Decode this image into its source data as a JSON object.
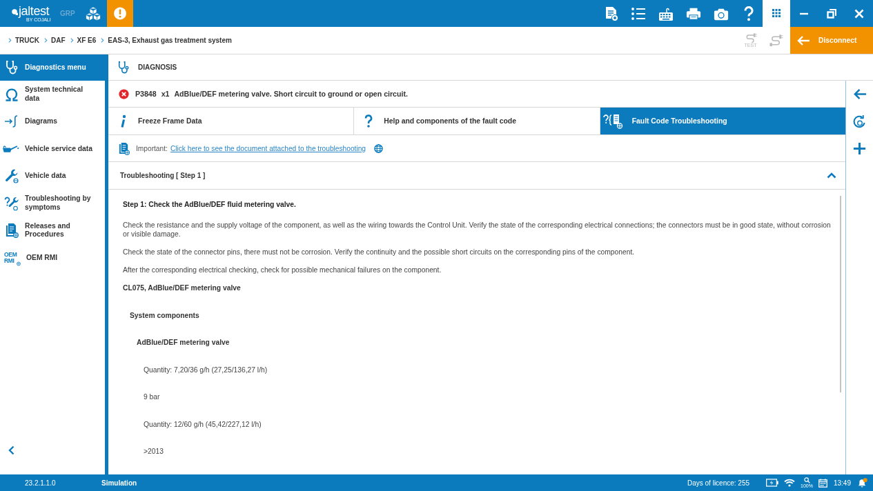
{
  "top_bar": {
    "logo": "jaltest",
    "logo_byline": "BY COJALI",
    "mode_label": "GRP",
    "apps_button": {
      "selected": true
    }
  },
  "breadcrumb": [
    "TRUCK",
    "DAF",
    "XF E6",
    "EAS-3, Exhaust gas treatment system"
  ],
  "connection": {
    "test_label": "TEST",
    "disabled": true,
    "disconnect_label": "Disconnect"
  },
  "sidebar": {
    "items": [
      {
        "label": "Diagnostics menu",
        "selected": true
      },
      {
        "label": "System technical data",
        "selected": false
      },
      {
        "label": "Diagrams",
        "selected": false
      },
      {
        "label": "Vehicle service data",
        "selected": false
      },
      {
        "label": "Vehicle data",
        "selected": false
      },
      {
        "label": "Troubleshooting by symptoms",
        "selected": false
      },
      {
        "label": "Releases and Procedures",
        "selected": false
      },
      {
        "label": "OEM RMI",
        "selected": false,
        "icon_text": "OEM RMI"
      }
    ]
  },
  "page_title": "DIAGNOSIS",
  "fault": {
    "code": "P3848",
    "count": "x1",
    "description": "AdBlue/DEF metering valve. Short circuit to ground or open circuit."
  },
  "tabs": [
    {
      "label": "Freeze Frame Data",
      "selected": false
    },
    {
      "label": "Help and components of the fault code",
      "selected": false
    },
    {
      "label": "Fault Code Troubleshooting",
      "selected": true
    }
  ],
  "notice": {
    "prefix": "Important:",
    "link": "Click here to see the document attached to the troubleshooting"
  },
  "section": {
    "title": "Troubleshooting [ Step 1 ]",
    "expanded": true,
    "heading": "Step 1: Check the AdBlue/DEF fluid metering valve.",
    "paragraphs": [
      "Check the resistance and the supply voltage of the component, as well as the wiring towards the Control Unit. Verify the state of the corresponding electrical connections; the connectors must be in good state, without corrosion or visible damage.",
      "Check the state of the connector pins, there must not be corrosion. Verify the continuity and the possible short circuits on the corresponding pins of the component.",
      "After the corresponding electrical checking, check for possible mechanical failures on the component."
    ],
    "components": [
      {
        "text": "CL075, AdBlue/DEF metering valve",
        "children": [
          {
            "text": "System components",
            "children": [
              {
                "text": "AdBlue/DEF metering valve",
                "children": [
                  {
                    "text": "Quantity: 7,20/36 g/h (27,25/136,27 l/h)"
                  },
                  {
                    "text": "9 bar"
                  },
                  {
                    "text": "Quantity: 12/60 g/h (45,42/227,12 l/h)"
                  },
                  {
                    "text": ">2013"
                  }
                ]
              }
            ]
          }
        ]
      }
    ]
  },
  "status_bar": {
    "version": "23.2.1.1.0",
    "mode": "Simulation",
    "licence": "Days of licence: 255",
    "zoom": "100%",
    "time": "13:49"
  }
}
